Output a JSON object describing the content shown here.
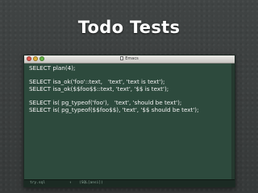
{
  "slide": {
    "title": "Todo Tests"
  },
  "window": {
    "title": "Emacs",
    "traffic_lights": {
      "close": "#e0584f",
      "minimize": "#e1b03a",
      "maximize": "#67b649"
    },
    "background": "#2d4a3d"
  },
  "editor": {
    "lines": [
      "SELECT plan(4);",
      "",
      "SELECT isa_ok('foo'::text,   'text', 'text is text');",
      "SELECT isa_ok($$foo$$::text, 'text', '$$ is text');",
      "",
      "SELECT is( pg_typeof('foo'),   'text', 'should be text');",
      "SELECT is( pg_typeof($$foo$$), 'text', '$$ should be text');"
    ]
  },
  "modeline": {
    "file": "try.sql",
    "arrow": "↑",
    "mode": "(SQL[ansi])"
  }
}
